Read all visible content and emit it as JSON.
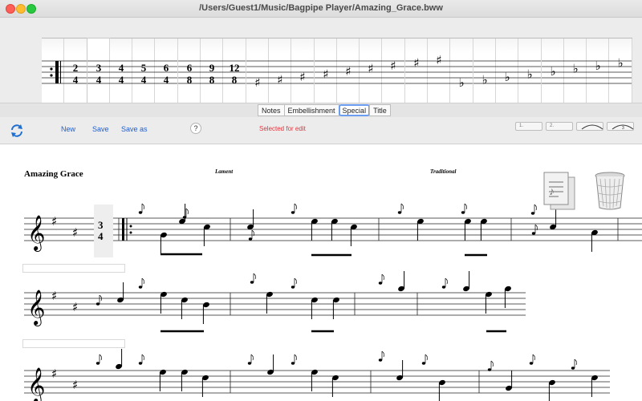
{
  "window": {
    "title": "/Users/Guest1/Music/Bagpipe Player/Amazing_Grace.bww"
  },
  "palette": {
    "items": [
      {
        "label": "''!I",
        "type": "repeat"
      },
      {
        "label": "2_4",
        "type": "time",
        "top": "2",
        "bottom": "4"
      },
      {
        "label": "3_4",
        "type": "time",
        "top": "3",
        "bottom": "4",
        "selected": true
      },
      {
        "label": "4_4",
        "type": "time",
        "top": "4",
        "bottom": "4"
      },
      {
        "label": "5_4",
        "type": "time",
        "top": "5",
        "bottom": "4"
      },
      {
        "label": "6_4",
        "type": "time",
        "top": "6",
        "bottom": "4"
      },
      {
        "label": "6_8",
        "type": "time",
        "top": "6",
        "bottom": "8"
      },
      {
        "label": "9_8",
        "type": "time",
        "top": "9",
        "bottom": "8"
      },
      {
        "label": "12_8",
        "type": "time",
        "top": "12",
        "bottom": "8"
      },
      {
        "label": "sharplg",
        "type": "sharp",
        "step": 8
      },
      {
        "label": "sharpla",
        "type": "sharp",
        "step": 7
      },
      {
        "label": "sharpb",
        "type": "sharp",
        "step": 6
      },
      {
        "label": "sharpc",
        "type": "sharp",
        "step": 5
      },
      {
        "label": "sharpd",
        "type": "sharp",
        "step": 4
      },
      {
        "label": "sharpe",
        "type": "sharp",
        "step": 3
      },
      {
        "label": "sharpf",
        "type": "sharp",
        "step": 2
      },
      {
        "label": "sharphg",
        "type": "sharp",
        "step": 1
      },
      {
        "label": "sharpha",
        "type": "sharp",
        "step": 0
      },
      {
        "label": "flatlg",
        "type": "flat",
        "step": 8
      },
      {
        "label": "flatla",
        "type": "flat",
        "step": 7
      },
      {
        "label": "flatb",
        "type": "flat",
        "step": 6
      },
      {
        "label": "flatc",
        "type": "flat",
        "step": 5
      },
      {
        "label": "flatd",
        "type": "flat",
        "step": 4
      },
      {
        "label": "flate",
        "type": "flat",
        "step": 3
      },
      {
        "label": "flatf",
        "type": "flat",
        "step": 2
      },
      {
        "label": "flathg",
        "type": "flat",
        "step": 1
      }
    ]
  },
  "tabs": [
    {
      "label": "Notes",
      "active": false
    },
    {
      "label": "Embellishment",
      "active": false
    },
    {
      "label": "Special",
      "active": true
    },
    {
      "label": "Title",
      "active": false
    }
  ],
  "toolbar": {
    "new_label": "New",
    "save_label": "Save",
    "save_as_label": "Save as",
    "help_label": "?",
    "status_text": "Selected for edit",
    "tie_buttons": [
      "1.",
      "2.",
      "",
      "3"
    ]
  },
  "score": {
    "title": "Amazing Grace",
    "tune_type": "Lament",
    "composer": "Traditional",
    "time_signature": {
      "top": "3",
      "bottom": "4"
    }
  },
  "colors": {
    "accent": "#1f5fcf",
    "status": "#e8323a",
    "tab_focus": "#6b9ef0"
  }
}
